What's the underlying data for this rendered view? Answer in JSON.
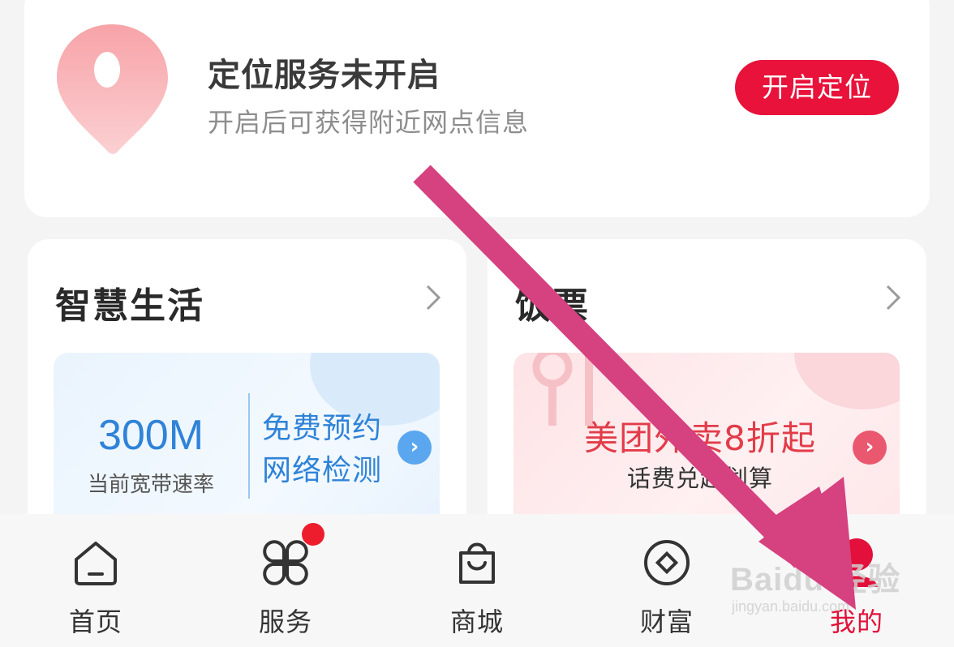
{
  "location_card": {
    "title": "定位服务未开启",
    "subtitle": "开启后可获得附近网点信息",
    "button_label": "开启定位"
  },
  "sections": [
    {
      "title": "智慧生活",
      "promo": {
        "speed_value": "300M",
        "speed_label": "当前宽带速率",
        "cta_line1": "免费预约",
        "cta_line2": "网络检测"
      }
    },
    {
      "title": "饭票",
      "promo": {
        "headline": "美团外卖8折起",
        "subline": "话费兑起划算"
      }
    }
  ],
  "bottom_nav": [
    {
      "label": "首页",
      "icon": "home-icon",
      "active": false
    },
    {
      "label": "服务",
      "icon": "services-grid-icon",
      "active": false,
      "badge": true
    },
    {
      "label": "商城",
      "icon": "shopping-bag-icon",
      "active": false
    },
    {
      "label": "财富",
      "icon": "wealth-coin-icon",
      "active": false
    },
    {
      "label": "我的",
      "icon": "profile-icon",
      "active": true
    }
  ],
  "watermark": {
    "brand": "Baidu 经验",
    "url": "jingyan.baidu.com"
  },
  "colors": {
    "accent_red": "#e8123a",
    "blue": "#2f83d8",
    "arrow_magenta": "#d6417f"
  }
}
